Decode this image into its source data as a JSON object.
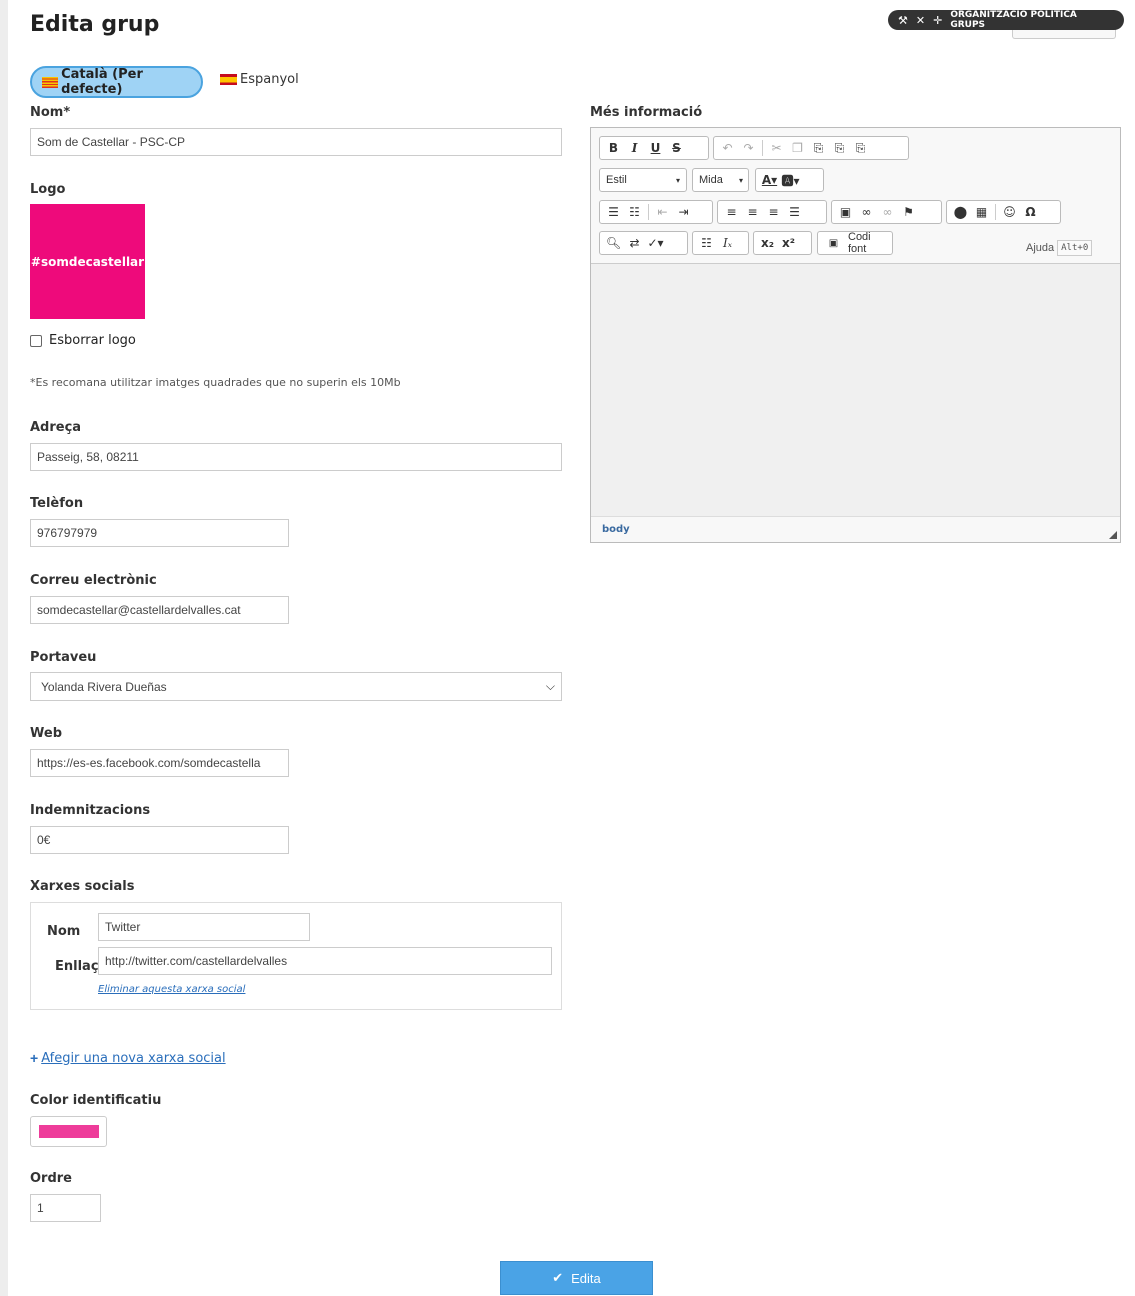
{
  "page": {
    "title": "Edita grup"
  },
  "admin_bar": {
    "label": "ORGANITZACIÓ POLÍTICA GRUPS",
    "icons": [
      "wrench-icon",
      "close-icon",
      "move-icon"
    ]
  },
  "languages": [
    {
      "label": "Català (Per defecte)",
      "active": true,
      "flag": "catalan-flag"
    },
    {
      "label": "Espanyol",
      "active": false,
      "flag": "spanish-flag"
    }
  ],
  "form": {
    "nom": {
      "label": "Nom*",
      "value": "Som de Castellar - PSC-CP"
    },
    "logo": {
      "label": "Logo",
      "image_text": "#somdecastellar",
      "image_color": "#ee0a7b"
    },
    "delete_logo": {
      "label": "Esborrar logo",
      "checked": false
    },
    "logo_hint": "*Es recomana utilitzar imatges quadrades que no superin els 10Mb",
    "adreca": {
      "label": "Adreça",
      "value": "Passeig, 58, 08211"
    },
    "telefon": {
      "label": "Telèfon",
      "value": "976797979"
    },
    "correu": {
      "label": "Correu electrònic",
      "value": "somdecastellar@castellardelvalles.cat"
    },
    "portaveu": {
      "label": "Portaveu",
      "value": "Yolanda Rivera Dueñas"
    },
    "web": {
      "label": "Web",
      "value": "https://es-es.facebook.com/somdecastella"
    },
    "indemnitzacions": {
      "label": "Indemnitzacions",
      "value": "0€"
    },
    "xarxes": {
      "label": "Xarxes socials",
      "nom_label": "Nom",
      "enllac_label": "Enllaç",
      "items": [
        {
          "nom": "Twitter",
          "enllac": "http://twitter.com/castellardelvalles"
        }
      ],
      "remove_label": "Eliminar aquesta xarxa social",
      "add_label": "Afegir una nova xarxa social"
    },
    "color": {
      "label": "Color identificatiu",
      "value": "#ee3c9a"
    },
    "ordre": {
      "label": "Ordre",
      "value": "1"
    },
    "submit_label": "Edita"
  },
  "editor": {
    "label": "Més informació",
    "style_combo": "Estil",
    "size_combo": "Mida",
    "source_label": "Codi font",
    "help_label": "Ajuda",
    "help_shortcut": "Alt+0",
    "status_path": "body",
    "toolbar_row1": {
      "bold": "B",
      "italic": "I",
      "underline": "U",
      "strike": "S"
    }
  }
}
